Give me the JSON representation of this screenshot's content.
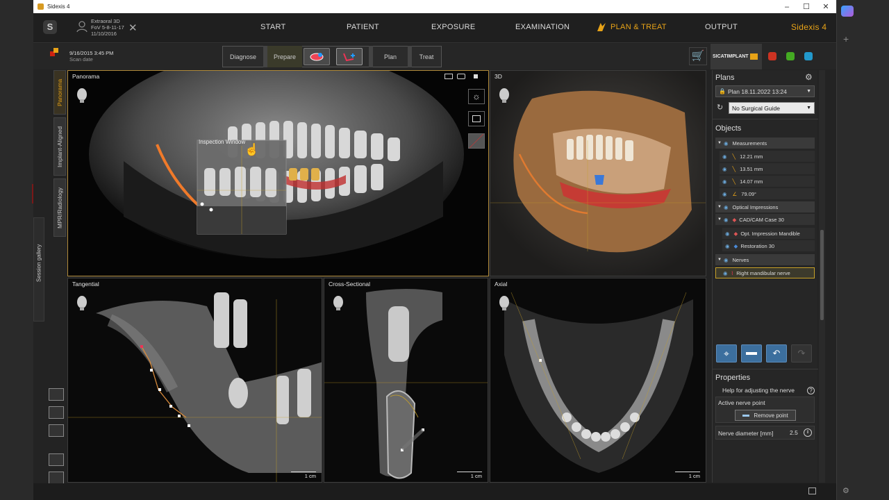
{
  "window": {
    "title": "Sidexis 4"
  },
  "header": {
    "patient": {
      "name": "Extraoral 3D",
      "fov": "FoV 5-8-11-17",
      "date": "11/10/2016"
    },
    "tabs": [
      "START",
      "PATIENT",
      "EXPOSURE",
      "EXAMINATION",
      "PLAN & TREAT",
      "OUTPUT"
    ],
    "brand": "Sidexis 4",
    "accent": "#e8a317"
  },
  "scan": {
    "datetime": "9/16/2015 3:45 PM",
    "label": "Scan date"
  },
  "workflow": [
    "Diagnose",
    "Prepare",
    "Plan",
    "Treat"
  ],
  "sicat": {
    "label": "SICATIMPLANT"
  },
  "views": {
    "panorama": "Panorama",
    "inspection": "Inspection Window",
    "threeD": "3D",
    "tangential": "Tangential",
    "cross": "Cross-Sectional",
    "axial": "Axial",
    "scale": "1 cm"
  },
  "side_tabs": [
    "Panorama",
    "Implant-Aligned",
    "MPR/Radiology"
  ],
  "session_gallery": "Session gallery",
  "plans": {
    "title": "Plans",
    "selected": "Plan 18.11.2022 13:24",
    "guide": "No Surgical Guide"
  },
  "objects": {
    "title": "Objects",
    "measurements_label": "Measurements",
    "measurements": [
      "12.21 mm",
      "13.51 mm",
      "14.07 mm",
      "79.09°"
    ],
    "optical_label": "Optical Impressions",
    "cad_case": "CAD/CAM Case 30",
    "opt_impression": "Opt. Impression Mandible",
    "restoration": "Restoration 30",
    "nerves_label": "Nerves",
    "nerve": "Right mandibular nerve"
  },
  "properties": {
    "title": "Properties",
    "help": "Help for adjusting the nerve",
    "active_point": "Active nerve point",
    "remove_btn": "Remove point",
    "diameter_label": "Nerve diameter [mm]",
    "diameter_value": "2.5"
  }
}
